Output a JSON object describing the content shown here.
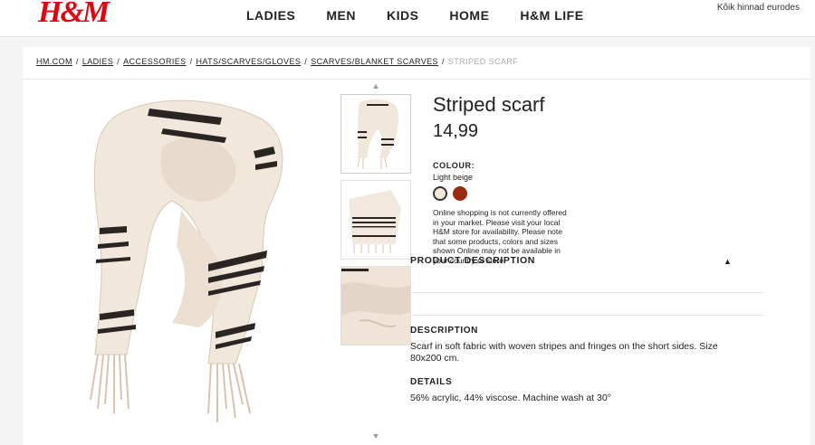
{
  "header": {
    "logo": "H&M",
    "nav": [
      "LADIES",
      "MEN",
      "KIDS",
      "HOME",
      "H&M LIFE"
    ],
    "prices_note": "Kõik hinnad eurodes"
  },
  "breadcrumb": {
    "items": [
      "HM.COM",
      "LADIES",
      "ACCESSORIES",
      "HATS/SCARVES/GLOVES",
      "SCARVES/BLANKET SCARVES"
    ],
    "current": "STRIPED SCARF"
  },
  "product": {
    "title": "Striped scarf",
    "price": "14,99",
    "colour_label": "COLOUR:",
    "colour_value": "Light beige",
    "swatches": [
      {
        "name": "Light beige",
        "color": "#f3e8dc"
      },
      {
        "name": "Rust",
        "color": "#9a2a12"
      }
    ],
    "notice": "Online shopping is not currently offered in your market. Please visit your local H&M store for availability. Please note that some products, colors and sizes shown Online may not be available in your country or store."
  },
  "description": {
    "header": "PRODUCT DESCRIPTION",
    "desc_heading": "DESCRIPTION",
    "desc_text": "Scarf in soft fabric with woven stripes and fringes on the short sides. Size 80x200 cm.",
    "details_heading": "DETAILS",
    "details_text": "56% acrylic, 44% viscose. Machine wash at 30°"
  }
}
